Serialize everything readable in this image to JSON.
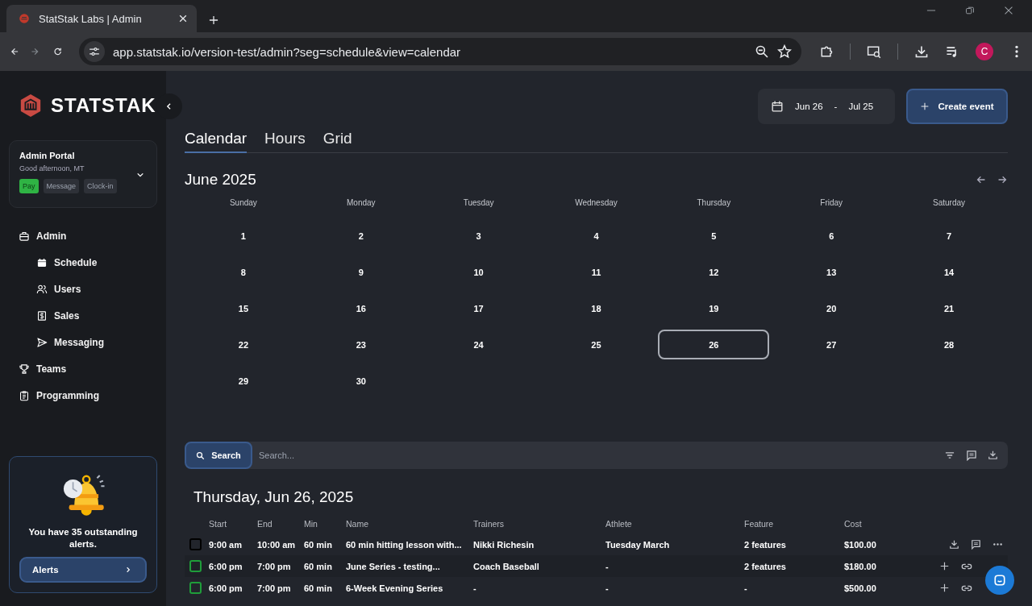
{
  "browser": {
    "tab_title": "StatStak Labs | Admin",
    "url": "app.statstak.io/version-test/admin?seg=schedule&view=calendar",
    "avatar_letter": "C"
  },
  "sidebar": {
    "logo_text": "STATSTAK",
    "portal": {
      "title": "Admin Portal",
      "greeting": "Good afternoon, MT",
      "buttons": [
        {
          "label": "Pay",
          "kind": "primary"
        },
        {
          "label": "Message",
          "kind": "plain"
        },
        {
          "label": "Clock-in",
          "kind": "plain"
        }
      ]
    },
    "nav": [
      {
        "label": "Admin",
        "children": [
          {
            "label": "Schedule"
          },
          {
            "label": "Users"
          },
          {
            "label": "Sales"
          },
          {
            "label": "Messaging"
          }
        ]
      },
      {
        "label": "Teams"
      },
      {
        "label": "Programming"
      }
    ],
    "alert": {
      "message": "You have 35 outstanding alerts.",
      "button": "Alerts"
    }
  },
  "header": {
    "date_start": "Jun 26",
    "date_separator": "-",
    "date_end": "Jul 25",
    "create_button": "Create event"
  },
  "view_tabs": [
    {
      "label": "Calendar",
      "selected": true
    },
    {
      "label": "Hours",
      "selected": false
    },
    {
      "label": "Grid",
      "selected": false
    }
  ],
  "calendar": {
    "month_title": "June 2025",
    "weekdays": [
      "Sunday",
      "Monday",
      "Tuesday",
      "Wednesday",
      "Thursday",
      "Friday",
      "Saturday"
    ],
    "days": [
      {
        "day": "1",
        "selected": false
      },
      {
        "day": "2",
        "selected": false
      },
      {
        "day": "3",
        "selected": false
      },
      {
        "day": "4",
        "selected": false
      },
      {
        "day": "5",
        "selected": false
      },
      {
        "day": "6",
        "selected": false
      },
      {
        "day": "7",
        "selected": false
      },
      {
        "day": "8",
        "selected": false
      },
      {
        "day": "9",
        "selected": false
      },
      {
        "day": "10",
        "selected": false
      },
      {
        "day": "11",
        "selected": false
      },
      {
        "day": "12",
        "selected": false
      },
      {
        "day": "13",
        "selected": false
      },
      {
        "day": "14",
        "selected": false
      },
      {
        "day": "15",
        "selected": false
      },
      {
        "day": "16",
        "selected": false
      },
      {
        "day": "17",
        "selected": false
      },
      {
        "day": "18",
        "selected": false
      },
      {
        "day": "19",
        "selected": false
      },
      {
        "day": "20",
        "selected": false
      },
      {
        "day": "21",
        "selected": false
      },
      {
        "day": "22",
        "selected": false
      },
      {
        "day": "23",
        "selected": false
      },
      {
        "day": "24",
        "selected": false
      },
      {
        "day": "25",
        "selected": false
      },
      {
        "day": "26",
        "selected": true
      },
      {
        "day": "27",
        "selected": false
      },
      {
        "day": "28",
        "selected": false
      },
      {
        "day": "29",
        "selected": false
      },
      {
        "day": "30",
        "selected": false
      }
    ]
  },
  "search": {
    "button": "Search",
    "placeholder": "Search..."
  },
  "events": {
    "date_title": "Thursday, Jun 26, 2025",
    "columns": [
      "Start",
      "End",
      "Min",
      "Name",
      "Trainers",
      "Athlete",
      "Feature",
      "Cost"
    ],
    "rows": [
      {
        "kind": "single",
        "color": "#000000",
        "cells": [
          "9:00 am",
          "10:00 am",
          "60 min",
          "60 min hitting lesson with...",
          "Nikki Richesin",
          "Tuesday March",
          "2 features",
          "$100.00"
        ]
      },
      {
        "kind": "series",
        "color": "#1f9d3a",
        "cells": [
          "6:00 pm",
          "7:00 pm",
          "60 min",
          "June Series - testing...",
          "Coach Baseball",
          "-",
          "2 features",
          "$180.00"
        ]
      },
      {
        "kind": "series",
        "color": "#1f9d3a",
        "cells": [
          "6:00 pm",
          "7:00 pm",
          "60 min",
          "6-Week Evening Series",
          "-",
          "-",
          "-",
          "$500.00"
        ]
      }
    ]
  }
}
